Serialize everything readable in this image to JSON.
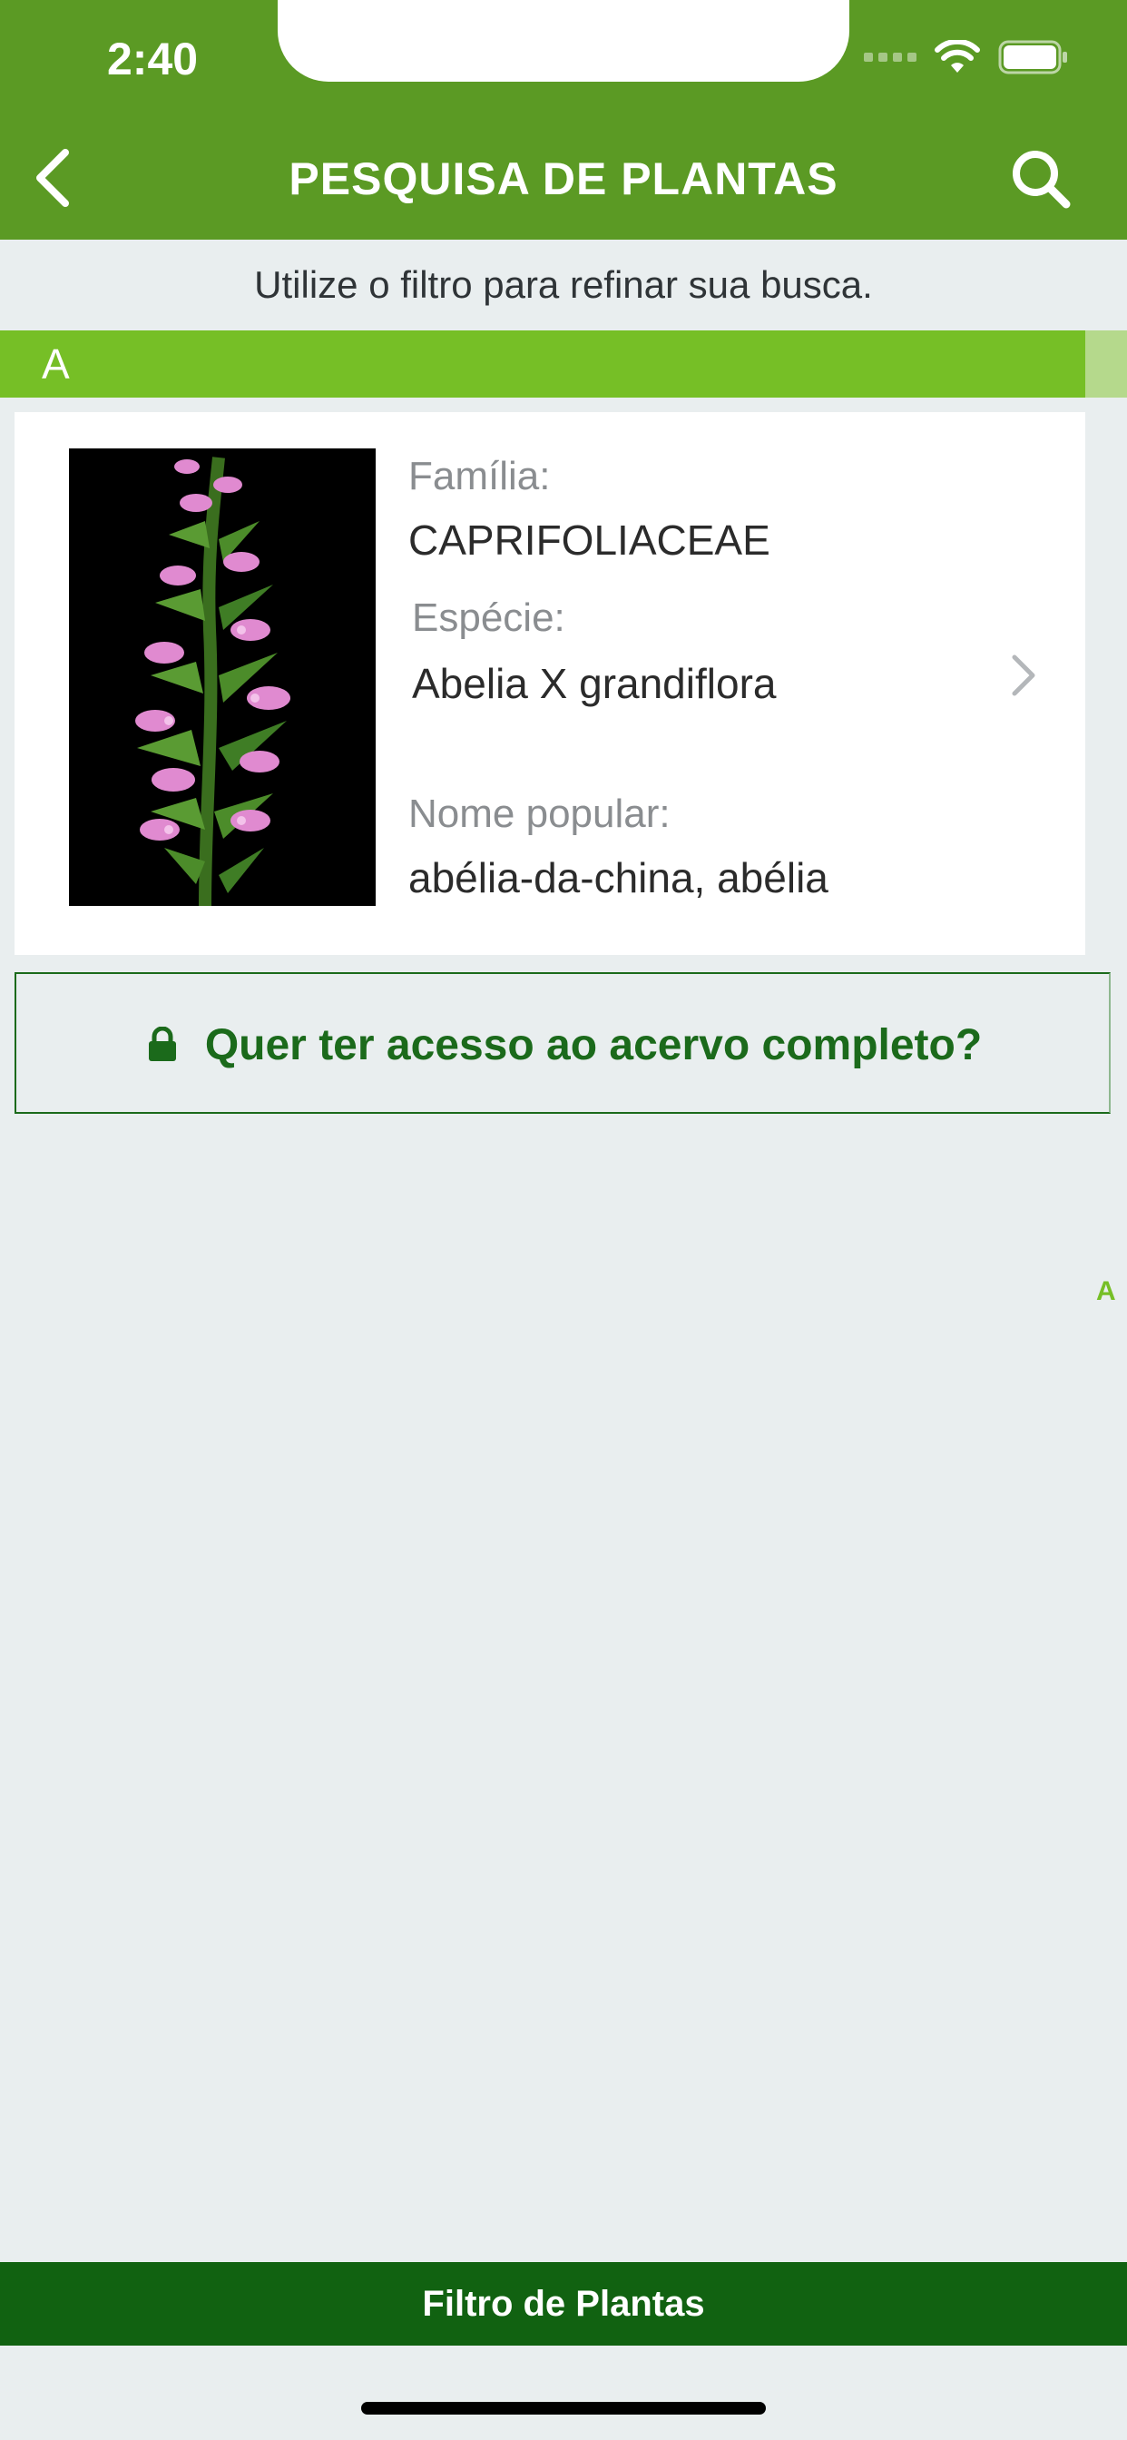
{
  "status_bar": {
    "time": "2:40"
  },
  "header": {
    "title": "PESQUISA DE PLANTAS",
    "back_icon": "chevron-left-icon",
    "search_icon": "search-icon",
    "color": "#5b9a24"
  },
  "hint": "Utilize o filtro para refinar sua busca.",
  "section": {
    "letter": "A",
    "color": "#76bf26"
  },
  "plant": {
    "family_label": "Família:",
    "family": "CAPRIFOLIACEAE",
    "species_label": "Espécie:",
    "species": "Abelia X grandiflora",
    "popular_label": "Nome popular:",
    "popular": "abélia-da-china, abélia"
  },
  "access": {
    "label": "Quer ter acesso ao acervo completo?",
    "icon": "lock-icon",
    "color": "#1b6a1b"
  },
  "index": {
    "letters": [
      "A"
    ]
  },
  "bottom": {
    "filter_label": "Filtro de Plantas",
    "color": "#116211"
  }
}
